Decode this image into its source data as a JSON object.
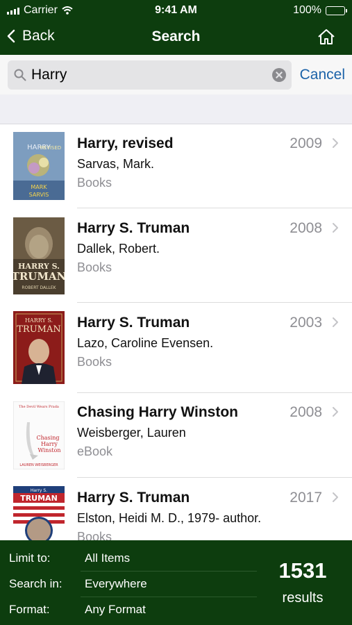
{
  "status": {
    "carrier": "Carrier",
    "time": "9:41 AM",
    "battery": "100%"
  },
  "nav": {
    "back_label": "Back",
    "title": "Search"
  },
  "search": {
    "value": "Harry",
    "cancel_label": "Cancel"
  },
  "results": [
    {
      "title": "Harry, revised",
      "author": "Sarvas, Mark.",
      "format": "Books",
      "year": "2009",
      "cover": {
        "line1": "HARRY",
        "line2": "REVISED",
        "name1": "MARK",
        "name2": "SARVIS"
      }
    },
    {
      "title": "Harry S. Truman",
      "author": "Dallek, Robert.",
      "format": "Books",
      "year": "2008",
      "cover": {
        "line1": "HARRY S.",
        "line2": "TRUMAN",
        "name1": "ROBERT DALLEK"
      }
    },
    {
      "title": "Harry S. Truman",
      "author": "Lazo, Caroline Evensen.",
      "format": "Books",
      "year": "2003",
      "cover": {
        "line1": "HARRY S.",
        "line2": "TRUMAN"
      }
    },
    {
      "title": "Chasing Harry Winston",
      "author": "Weisberger, Lauren",
      "format": "eBook",
      "year": "2008",
      "cover": {
        "line1": "The Devil Wears Prada",
        "line2": "Chasing",
        "line3": "Harry",
        "line4": "Winston",
        "name1": "LAUREN WEISBERGER"
      }
    },
    {
      "title": "Harry S. Truman",
      "author": "Elston, Heidi M. D., 1979- author.",
      "format": "Books",
      "year": "2017",
      "cover": {
        "line1": "Harry S.",
        "line2": "TRUMAN"
      }
    }
  ],
  "footer": {
    "limit_label": "Limit to:",
    "limit_value": "All Items",
    "search_label": "Search in:",
    "search_value": "Everywhere",
    "format_label": "Format:",
    "format_value": "Any Format",
    "count": "1531",
    "count_label": "results"
  },
  "colors": {
    "brand": "#0d3d0e",
    "accent": "#1a62a8",
    "secondary_text": "#8e8e93"
  }
}
